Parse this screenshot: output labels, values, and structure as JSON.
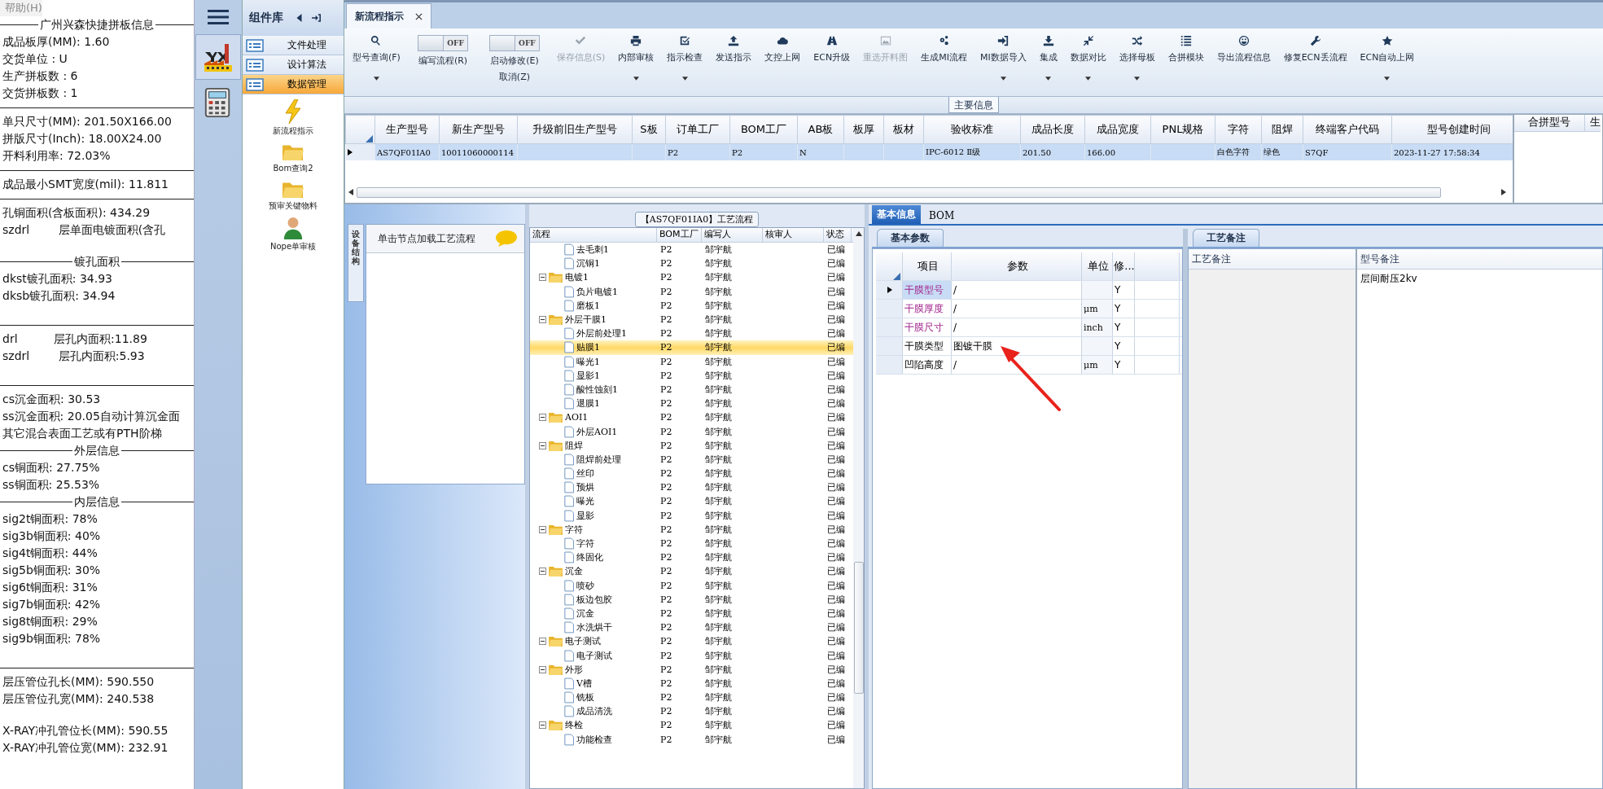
{
  "menu": {
    "label": "帮助(H)"
  },
  "info_panel": [
    {
      "kind": "heading",
      "text": "广州兴森快捷拼板信息"
    },
    {
      "kind": "text",
      "text": "成品板厚(MM): 1.60"
    },
    {
      "kind": "text",
      "text": "交货单位 : U"
    },
    {
      "kind": "text",
      "text": "生产拼板数 : 6"
    },
    {
      "kind": "text",
      "text": "交货拼板数 : 1"
    },
    {
      "kind": "rule"
    },
    {
      "kind": "text",
      "text": "单只尺寸(MM): 201.50X166.00"
    },
    {
      "kind": "text",
      "text": "拼版尺寸(Inch): 18.00X24.00"
    },
    {
      "kind": "text",
      "text": "开料利用率: 72.03%"
    },
    {
      "kind": "rule"
    },
    {
      "kind": "text",
      "text": "成品最小SMT宽度(mil): 11.811"
    },
    {
      "kind": "rule"
    },
    {
      "kind": "text",
      "text": "孔铜面积(含板面积): 434.29"
    },
    {
      "kind": "text",
      "text": "szdrl        层单面电镀面积(含孔"
    },
    {
      "kind": "gap"
    },
    {
      "kind": "heading",
      "text": "镀孔面积"
    },
    {
      "kind": "text",
      "text": "dkst镀孔面积: 34.93"
    },
    {
      "kind": "text",
      "text": "dksb镀孔面积: 34.94"
    },
    {
      "kind": "gap"
    },
    {
      "kind": "rule"
    },
    {
      "kind": "text",
      "text": "drl          层孔内面积:11.89"
    },
    {
      "kind": "text",
      "text": "szdrl        层孔内面积:5.93"
    },
    {
      "kind": "gap"
    },
    {
      "kind": "rule"
    },
    {
      "kind": "text",
      "text": "cs沉金面积: 30.53"
    },
    {
      "kind": "text",
      "text": "ss沉金面积: 20.05自动计算沉金面"
    },
    {
      "kind": "text",
      "text": "其它混合表面工艺或有PTH阶梯"
    },
    {
      "kind": "heading",
      "text": "外层信息"
    },
    {
      "kind": "text",
      "text": "cs铜面积: 27.75%"
    },
    {
      "kind": "text",
      "text": "ss铜面积: 25.53%"
    },
    {
      "kind": "heading",
      "text": "内层信息"
    },
    {
      "kind": "text",
      "text": "sig2t铜面积: 78%"
    },
    {
      "kind": "text",
      "text": "sig3b铜面积: 40%"
    },
    {
      "kind": "text",
      "text": "sig4t铜面积: 44%"
    },
    {
      "kind": "text",
      "text": "sig5b铜面积: 30%"
    },
    {
      "kind": "text",
      "text": "sig6t铜面积: 31%"
    },
    {
      "kind": "text",
      "text": "sig7b铜面积: 42%"
    },
    {
      "kind": "text",
      "text": "sig8t铜面积: 29%"
    },
    {
      "kind": "text",
      "text": "sig9b铜面积: 78%"
    },
    {
      "kind": "gap"
    },
    {
      "kind": "rule"
    },
    {
      "kind": "text",
      "text": "层压管位孔长(MM): 590.550"
    },
    {
      "kind": "text",
      "text": "层压管位孔宽(MM): 240.538"
    },
    {
      "kind": "gap"
    },
    {
      "kind": "text",
      "text": "X-RAY冲孔管位长(MM): 590.55"
    },
    {
      "kind": "text",
      "text": "X-RAY冲孔管位宽(MM): 232.91"
    }
  ],
  "rail": [
    {
      "selected": false
    },
    {
      "selected": true
    },
    {
      "selected": false
    }
  ],
  "component_panel": {
    "title": "组件库",
    "categories": [
      {
        "label": "文件处理",
        "selected": false
      },
      {
        "label": "设计算法",
        "selected": false
      },
      {
        "label": "数据管理",
        "selected": true
      }
    ],
    "tools": [
      {
        "label": "新流程指示"
      },
      {
        "label": "Bom查询2"
      },
      {
        "label": "预审关键物料"
      },
      {
        "label": "Nope单审核"
      }
    ]
  },
  "tabs": [
    {
      "label": "新流程指示",
      "selected": true,
      "closable": true
    }
  ],
  "toolbar": [
    {
      "kind": "button",
      "labels": [
        "型号查询(F)"
      ],
      "disabled": false,
      "has_menu": true
    },
    {
      "kind": "toggle",
      "switch_text": "OFF",
      "on": false,
      "labels": [
        "编写流程(R)"
      ]
    },
    {
      "kind": "toggle",
      "switch_text": "OFF",
      "on": false,
      "labels": [
        "启动修改(E)",
        "取消(Z)"
      ]
    },
    {
      "kind": "button",
      "labels": [
        "保存信息(S)"
      ],
      "disabled": true,
      "has_menu": false
    },
    {
      "kind": "button",
      "labels": [
        "内部审核"
      ],
      "disabled": false,
      "has_menu": true
    },
    {
      "kind": "button",
      "labels": [
        "指示检查"
      ],
      "disabled": false,
      "has_menu": true
    },
    {
      "kind": "button",
      "labels": [
        "发送指示"
      ],
      "disabled": false,
      "has_menu": false
    },
    {
      "kind": "button",
      "labels": [
        "文控上网"
      ],
      "disabled": false,
      "has_menu": false
    },
    {
      "kind": "button",
      "labels": [
        "ECN升级"
      ],
      "disabled": false,
      "has_menu": false
    },
    {
      "kind": "button",
      "labels": [
        "重选开料图"
      ],
      "disabled": true,
      "has_menu": false
    },
    {
      "kind": "button",
      "labels": [
        "生成MI流程"
      ],
      "disabled": false,
      "has_menu": false
    },
    {
      "kind": "button",
      "labels": [
        "MI数据导入"
      ],
      "disabled": false,
      "has_menu": true
    },
    {
      "kind": "button",
      "labels": [
        "集成"
      ],
      "disabled": false,
      "has_menu": true
    },
    {
      "kind": "button",
      "labels": [
        "数据对比"
      ],
      "disabled": false,
      "has_menu": true
    },
    {
      "kind": "button",
      "labels": [
        "选择母板"
      ],
      "disabled": false,
      "has_menu": true
    },
    {
      "kind": "button",
      "labels": [
        "合拼模块"
      ],
      "disabled": false,
      "has_menu": false
    },
    {
      "kind": "button",
      "labels": [
        "导出流程信息"
      ],
      "disabled": false,
      "has_menu": false
    },
    {
      "kind": "button",
      "labels": [
        "修复ECN丢流程"
      ],
      "disabled": false,
      "has_menu": false
    },
    {
      "kind": "button",
      "labels": [
        "ECN自动上网"
      ],
      "disabled": false,
      "has_menu": true
    }
  ],
  "main_info": {
    "title": "主要信息",
    "columns": [
      "生产型号",
      "新生产型号",
      "升级前旧生产型号",
      "S板",
      "订单工厂",
      "BOM工厂",
      "AB板",
      "板厚",
      "板材",
      "验收标准",
      "成品长度",
      "成品宽度",
      "PNL规格",
      "字符",
      "阻焊",
      "终端客户代码",
      "型号创建时间"
    ],
    "rows": [
      {
        "selected": true,
        "cells": [
          "AS7QF01IA0",
          "10011060000114",
          null,
          null,
          "P2",
          "P2",
          "N",
          null,
          null,
          "IPC-6012 Ⅱ级",
          "201.50",
          "166.00",
          null,
          "白色字符",
          "绿色",
          "S7QF",
          "2023-11-27 17:58:34"
        ]
      }
    ],
    "side_columns": [
      "合拼型号",
      "生"
    ]
  },
  "left_tab": {
    "label": "设备结构"
  },
  "hint": {
    "text": "单击节点加载工艺流程"
  },
  "process_tree": {
    "title": "【AS7QF01IA0】工艺流程",
    "columns": [
      "流程",
      "BOM工厂",
      "编写人",
      "核审人",
      "状态"
    ],
    "nodes": [
      {
        "children": [
          {
            "label": "去毛刺1",
            "bom": "P2",
            "writer": "邹宇航",
            "status": "已编",
            "selected": false
          },
          {
            "label": "沉铜1",
            "bom": "P2",
            "writer": "邹宇航",
            "status": "已编",
            "selected": false
          }
        ]
      },
      {
        "label": "电镀1",
        "bom": "P2",
        "writer": "邹宇航",
        "status": "已编",
        "selected": false,
        "expanded": true,
        "children": [
          {
            "label": "负片电镀1",
            "bom": "P2",
            "writer": "邹宇航",
            "status": "已编",
            "selected": false
          },
          {
            "label": "磨板1",
            "bom": "P2",
            "writer": "邹宇航",
            "status": "已编",
            "selected": false
          }
        ]
      },
      {
        "label": "外层干膜1",
        "bom": "P2",
        "writer": "邹宇航",
        "status": "已编",
        "selected": false,
        "expanded": true,
        "children": [
          {
            "label": "外层前处理1",
            "bom": "P2",
            "writer": "邹宇航",
            "status": "已编",
            "selected": false
          },
          {
            "label": "贴膜1",
            "bom": "P2",
            "writer": "邹宇航",
            "status": "已编",
            "selected": true
          },
          {
            "label": "曝光1",
            "bom": "P2",
            "writer": "邹宇航",
            "status": "已编",
            "selected": false
          },
          {
            "label": "显影1",
            "bom": "P2",
            "writer": "邹宇航",
            "status": "已编",
            "selected": false
          },
          {
            "label": "酸性蚀刻1",
            "bom": "P2",
            "writer": "邹宇航",
            "status": "已编",
            "selected": false
          },
          {
            "label": "退膜1",
            "bom": "P2",
            "writer": "邹宇航",
            "status": "已编",
            "selected": false
          }
        ]
      },
      {
        "label": "AOI1",
        "bom": "P2",
        "writer": "邹宇航",
        "status": "已编",
        "selected": false,
        "expanded": true,
        "children": [
          {
            "label": "外层AOI1",
            "bom": "P2",
            "writer": "邹宇航",
            "status": "已编",
            "selected": false
          }
        ]
      },
      {
        "label": "阻焊",
        "bom": "P2",
        "writer": "邹宇航",
        "status": "已编",
        "selected": false,
        "expanded": true,
        "children": [
          {
            "label": "阻焊前处理",
            "bom": "P2",
            "writer": "邹宇航",
            "status": "已编",
            "selected": false
          },
          {
            "label": "丝印",
            "bom": "P2",
            "writer": "邹宇航",
            "status": "已编",
            "selected": false
          },
          {
            "label": "预烘",
            "bom": "P2",
            "writer": "邹宇航",
            "status": "已编",
            "selected": false
          },
          {
            "label": "曝光",
            "bom": "P2",
            "writer": "邹宇航",
            "status": "已编",
            "selected": false
          },
          {
            "label": "显影",
            "bom": "P2",
            "writer": "邹宇航",
            "status": "已编",
            "selected": false
          }
        ]
      },
      {
        "label": "字符",
        "bom": "P2",
        "writer": "邹宇航",
        "status": "已编",
        "selected": false,
        "expanded": true,
        "children": [
          {
            "label": "字符",
            "bom": "P2",
            "writer": "邹宇航",
            "status": "已编",
            "selected": false
          },
          {
            "label": "终固化",
            "bom": "P2",
            "writer": "邹宇航",
            "status": "已编",
            "selected": false
          }
        ]
      },
      {
        "label": "沉金",
        "bom": "P2",
        "writer": "邹宇航",
        "status": "已编",
        "selected": false,
        "expanded": true,
        "children": [
          {
            "label": "喷砂",
            "bom": "P2",
            "writer": "邹宇航",
            "status": "已编",
            "selected": false
          },
          {
            "label": "板边包胶",
            "bom": "P2",
            "writer": "邹宇航",
            "status": "已编",
            "selected": false
          },
          {
            "label": "沉金",
            "bom": "P2",
            "writer": "邹宇航",
            "status": "已编",
            "selected": false
          },
          {
            "label": "水洗烘干",
            "bom": "P2",
            "writer": "邹宇航",
            "status": "已编",
            "selected": false
          }
        ]
      },
      {
        "label": "电子测试",
        "bom": "P2",
        "writer": "邹宇航",
        "status": "已编",
        "selected": false,
        "expanded": true,
        "children": [
          {
            "label": "电子测试",
            "bom": "P2",
            "writer": "邹宇航",
            "status": "已编",
            "selected": false
          }
        ]
      },
      {
        "label": "外形",
        "bom": "P2",
        "writer": "邹宇航",
        "status": "已编",
        "selected": false,
        "expanded": true,
        "children": [
          {
            "label": "V槽",
            "bom": "P2",
            "writer": "邹宇航",
            "status": "已编",
            "selected": false
          },
          {
            "label": "铣板",
            "bom": "P2",
            "writer": "邹宇航",
            "status": "已编",
            "selected": false
          },
          {
            "label": "成品清洗",
            "bom": "P2",
            "writer": "邹宇航",
            "status": "已编",
            "selected": false
          }
        ]
      },
      {
        "label": "终检",
        "bom": "P2",
        "writer": "邹宇航",
        "status": "已编",
        "selected": false,
        "expanded": true,
        "children": [
          {
            "label": "功能检查",
            "bom": "P2",
            "writer": "邹宇航",
            "status": "已编",
            "selected": false
          }
        ]
      }
    ]
  },
  "detail_tabs": [
    {
      "label": "基本信息",
      "selected": true
    },
    {
      "label": "BOM",
      "selected": false
    }
  ],
  "params": {
    "tab": "基本参数",
    "columns": [
      "项目",
      "参数",
      "单位",
      "修..."
    ],
    "rows": [
      {
        "item": "干膜型号",
        "emphasized": true,
        "value": "/",
        "unit": null,
        "flag": "Y",
        "selected": true
      },
      {
        "item": "干膜厚度",
        "emphasized": true,
        "value": "/",
        "unit": "μm",
        "flag": "Y",
        "selected": false
      },
      {
        "item": "干膜尺寸",
        "emphasized": true,
        "value": "/",
        "unit": "inch",
        "flag": "Y",
        "selected": false
      },
      {
        "item": "干膜类型",
        "emphasized": false,
        "value": "图镀干膜",
        "unit": null,
        "flag": "Y",
        "selected": false
      },
      {
        "item": "凹陷高度",
        "emphasized": false,
        "value": "/",
        "unit": "μm",
        "flag": "Y",
        "selected": false
      }
    ]
  },
  "remarks": {
    "tab": "工艺备注",
    "columns": [
      "工艺备注",
      "型号备注"
    ],
    "model_remark": "层间耐压2kv"
  }
}
